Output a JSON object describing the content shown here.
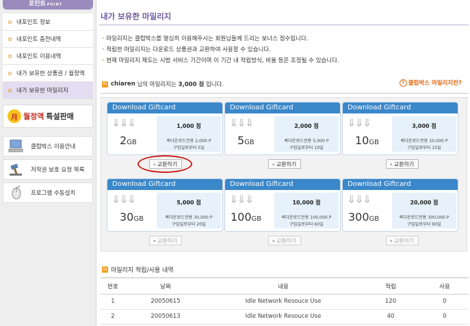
{
  "sidebar": {
    "header": "포인트",
    "header_sub": "POINT",
    "items": [
      {
        "label": "내포인트 정보",
        "active": false
      },
      {
        "label": "내포인트 충전내역",
        "active": false
      },
      {
        "label": "내포인트 이용내역",
        "active": false
      },
      {
        "label": "내가 보유한 상품권 / 월정액",
        "active": false
      },
      {
        "label": "내가 보유한 마일리지",
        "active": true
      }
    ],
    "promo": {
      "icon_text": "月",
      "text1": "월정액",
      "text2": "특설판매"
    },
    "services": [
      {
        "label": "클럽박스 이용안내",
        "icon": "computer-icon"
      },
      {
        "label": "저작권 보호 요청 목록",
        "icon": "gavel-icon"
      },
      {
        "label": "프로그램 수동설치",
        "icon": "mouse-icon"
      }
    ]
  },
  "main": {
    "title": "내가 보유한 마일리지",
    "notes": [
      "마일리지는 클럽박스를 열심히 이용해주시는 회원님들께 드리는 보너스 점수입니다.",
      "적립한 마일리지는 다운로드 상품권과 교환하여 사용할 수 있습니다.",
      "현재 마일리지 제도는 시범 서비스 기간이며 이 기간 내 적립방식, 비율 등은 조정될 수 있습니다."
    ],
    "mileage": {
      "icon_text": "01",
      "user": "chiaren",
      "text_mid": "님의 마일리지는",
      "points": "3,000 점",
      "text_end": "입니다.",
      "help_label": "클럽박스 마일리지란?"
    },
    "cards": [
      {
        "head": "Download Giftcard",
        "size_num": "2",
        "size_unit": "GB",
        "points": "1,000 점",
        "desc1": "퀵다운로드전용 2,000 P",
        "desc2": "구입일로부터 5일",
        "button": "교환하기",
        "enabled": true
      },
      {
        "head": "Download Giftcard",
        "size_num": "5",
        "size_unit": "GB",
        "points": "2,000 점",
        "desc1": "퀵다운로드전용 5,000 P",
        "desc2": "구입일로부터 10일",
        "button": "교환하기",
        "enabled": true
      },
      {
        "head": "Download Giftcard",
        "size_num": "10",
        "size_unit": "GB",
        "points": "3,000 점",
        "desc1": "퀵다운로드전용 10,000 P",
        "desc2": "구입일로부터 15일",
        "button": "교환하기",
        "enabled": true
      },
      {
        "head": "Download Giftcard",
        "size_num": "30",
        "size_unit": "GB",
        "points": "5,000 점",
        "desc1": "퀵다운로드전용 30,000 P",
        "desc2": "구입일로부터 20일",
        "button": "교환하기",
        "enabled": false
      },
      {
        "head": "Download Giftcard",
        "size_num": "100",
        "size_unit": "GB",
        "points": "10,000 점",
        "desc1": "퀵다운로드전용 100,000 P",
        "desc2": "구입일로부터 60일",
        "button": "교환하기",
        "enabled": false
      },
      {
        "head": "Download Giftcard",
        "size_num": "300",
        "size_unit": "GB",
        "points": "20,000 점",
        "desc1": "퀵다운로드전용 300,000 P",
        "desc2": "구입일로부터 90일",
        "button": "교환하기",
        "enabled": false
      }
    ],
    "history": {
      "icon_text": "02",
      "title": "마일리지 적립/사용 내역",
      "columns": [
        "번호",
        "날짜",
        "내용",
        "적립",
        "사용"
      ],
      "rows": [
        [
          "1",
          "20050615",
          "Idle Network Resouce Use",
          "120",
          "0"
        ],
        [
          "2",
          "20050613",
          "Idle Network Resouce Use",
          "40",
          "0"
        ]
      ]
    }
  },
  "colors": {
    "accent": "#6b5aa0",
    "card_head": "#3a87c9",
    "highlight": "#cc1c1c",
    "bullet": "#e08a1f"
  }
}
